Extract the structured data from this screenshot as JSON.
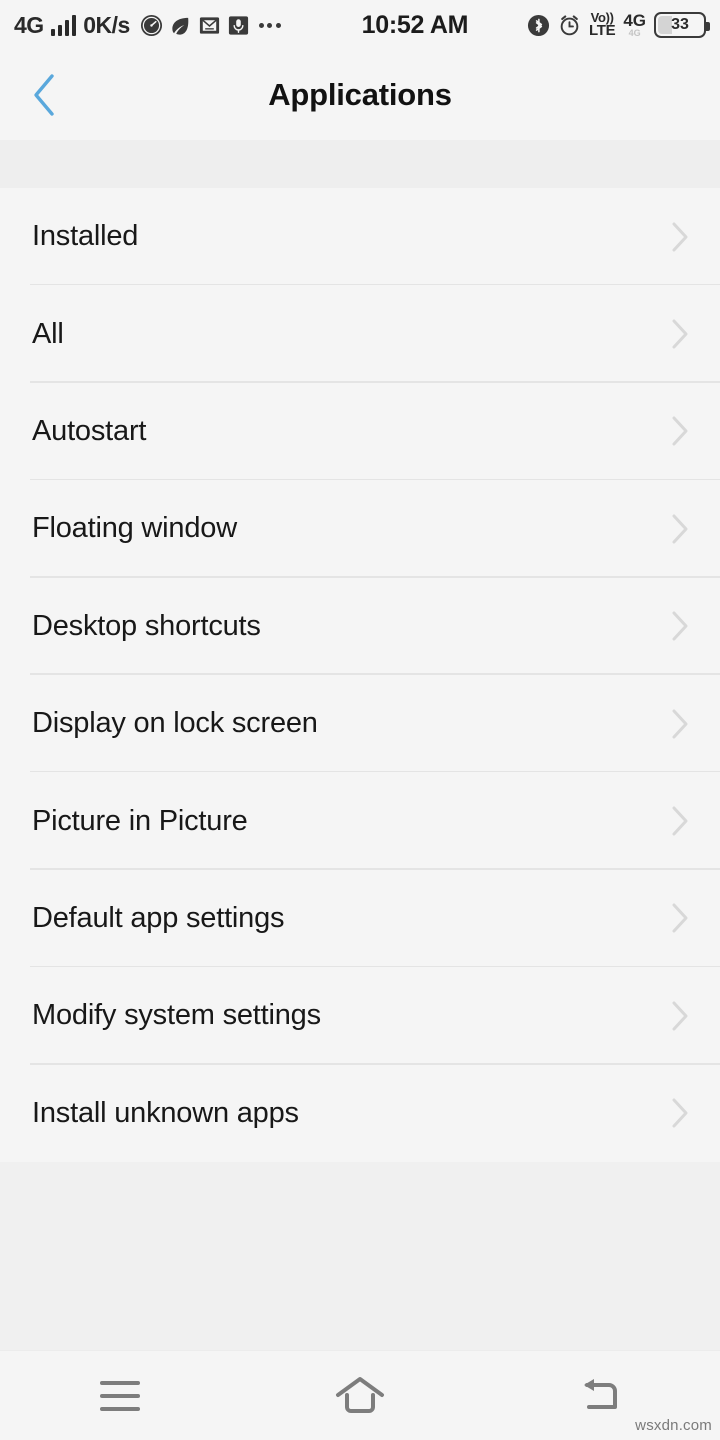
{
  "status_bar": {
    "network_type": "4G",
    "data_speed": "0K/s",
    "signal_bars": 4,
    "icons": [
      "speedometer-icon",
      "leaf-icon",
      "mail-icon",
      "microphone-icon",
      "overflow-dots-icon"
    ],
    "time": "10:52 AM",
    "right_icons": [
      "bluetooth-icon",
      "alarm-clock-icon"
    ],
    "volte_line1": "Vo))",
    "volte_line2": "LTE",
    "sim_network": "4G",
    "sim_sub": "4G",
    "battery_level": "33",
    "battery_percent": 33
  },
  "header": {
    "back_label": "Back",
    "title": "Applications",
    "back_icon_color": "#5aa8dc"
  },
  "list": {
    "items": [
      {
        "label": "Installed",
        "chevron": "chevron-right-icon"
      },
      {
        "label": "All",
        "chevron": "chevron-right-icon"
      },
      {
        "label": "Autostart",
        "chevron": "chevron-right-icon"
      },
      {
        "label": "Floating window",
        "chevron": "chevron-right-icon"
      },
      {
        "label": "Desktop shortcuts",
        "chevron": "chevron-right-icon"
      },
      {
        "label": "Display on lock screen",
        "chevron": "chevron-right-icon"
      },
      {
        "label": "Picture in Picture",
        "chevron": "chevron-right-icon"
      },
      {
        "label": "Default app settings",
        "chevron": "chevron-right-icon"
      },
      {
        "label": "Modify system settings",
        "chevron": "chevron-right-icon"
      },
      {
        "label": "Install unknown apps",
        "chevron": "chevron-right-icon"
      }
    ]
  },
  "navbar": {
    "menu_label": "Menu",
    "home_label": "Home",
    "back_label": "Back"
  },
  "watermark": {
    "text": "wsxdn.com"
  },
  "colors": {
    "screen_background": "#f0f0f0",
    "surface": "#f5f5f5",
    "spacer": "#eeeeee",
    "divider": "#e4e4e4",
    "text_primary": "#181818",
    "chevron": "#d8d8d8",
    "accent_blue": "#5aa8dc",
    "nav_icon": "#7d7d7d"
  }
}
